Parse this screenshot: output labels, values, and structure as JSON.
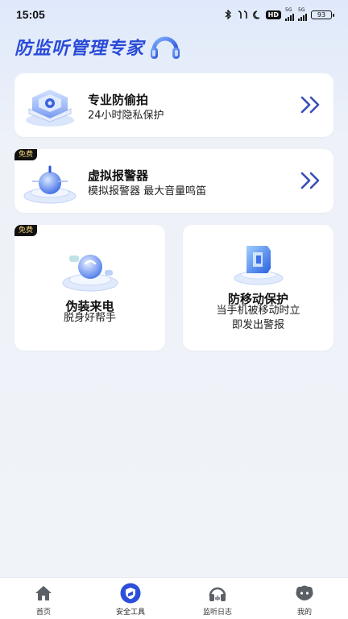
{
  "status_bar": {
    "time": "15:05",
    "battery": "93",
    "hd_label": "HD",
    "network": "5G"
  },
  "header": {
    "title": "防监听管理专家"
  },
  "features": [
    {
      "title": "专业防偷拍",
      "subtitle": "24小时隐私保护",
      "badge": ""
    },
    {
      "title": "虚拟报警器",
      "subtitle": "模拟报警器  最大音量鸣笛",
      "badge": "免费"
    },
    {
      "title": "伪装来电",
      "subtitle": "脱身好帮手",
      "badge": "免费"
    },
    {
      "title": "防移动保护",
      "subtitle_line1": "当手机被移动时立",
      "subtitle_line2": "即发出警报"
    }
  ],
  "tabs": [
    {
      "label": "首页",
      "icon": "home-icon"
    },
    {
      "label": "安全工具",
      "icon": "shield-icon"
    },
    {
      "label": "监听日志",
      "icon": "headphones-icon"
    },
    {
      "label": "我的",
      "icon": "profile-icon"
    }
  ],
  "colors": {
    "accent": "#2a4ad8",
    "chevron": "#3a4fb6",
    "badge_bg": "#111111",
    "badge_text": "#f6d27a"
  }
}
